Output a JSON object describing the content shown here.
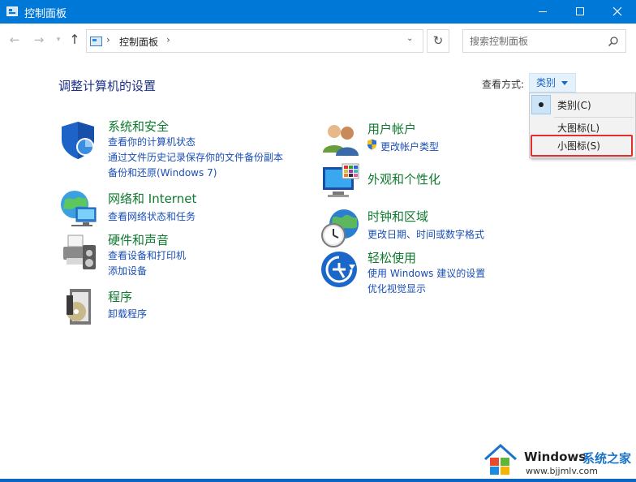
{
  "window": {
    "title": "控制面板"
  },
  "address_bar": {
    "path": [
      "控制面板"
    ],
    "search_placeholder": "搜索控制面板"
  },
  "main": {
    "heading": "调整计算机的设置",
    "view_by_label": "查看方式:",
    "view_by_value": "类别"
  },
  "view_menu": {
    "items": [
      {
        "label": "类别(C)",
        "selected": true
      },
      {
        "label": "大图标(L)",
        "selected": false
      },
      {
        "label": "小图标(S)",
        "selected": false,
        "highlighted": true
      }
    ]
  },
  "categories": [
    {
      "title": "系统和安全",
      "icon": "shield-icon",
      "links": [
        "查看你的计算机状态",
        "通过文件历史记录保存你的文件备份副本",
        "备份和还原(Windows 7)"
      ]
    },
    {
      "title": "网络和 Internet",
      "icon": "network-globe-icon",
      "links": [
        "查看网络状态和任务"
      ]
    },
    {
      "title": "硬件和声音",
      "icon": "printer-speaker-icon",
      "links": [
        "查看设备和打印机",
        "添加设备"
      ]
    },
    {
      "title": "程序",
      "icon": "programs-disc-icon",
      "links": [
        "卸载程序"
      ]
    },
    {
      "title": "用户帐户",
      "icon": "users-icon",
      "links": [
        "更改帐户类型"
      ]
    },
    {
      "title": "外观和个性化",
      "icon": "monitor-palette-icon",
      "links": []
    },
    {
      "title": "时钟和区域",
      "icon": "clock-globe-icon",
      "links": [
        "更改日期、时间或数字格式"
      ]
    },
    {
      "title": "轻松使用",
      "icon": "ease-of-access-icon",
      "links": [
        "使用 Windows 建议的设置",
        "优化视觉显示"
      ]
    }
  ],
  "watermark": {
    "brand": "Windows",
    "brand_suffix": "系统之家",
    "url": "www.bjjmlv.com"
  },
  "colors": {
    "titlebar": "#0078d7",
    "category_title": "#0e7a2e",
    "link": "#1a4fb5",
    "highlight_border": "#e0302c"
  }
}
